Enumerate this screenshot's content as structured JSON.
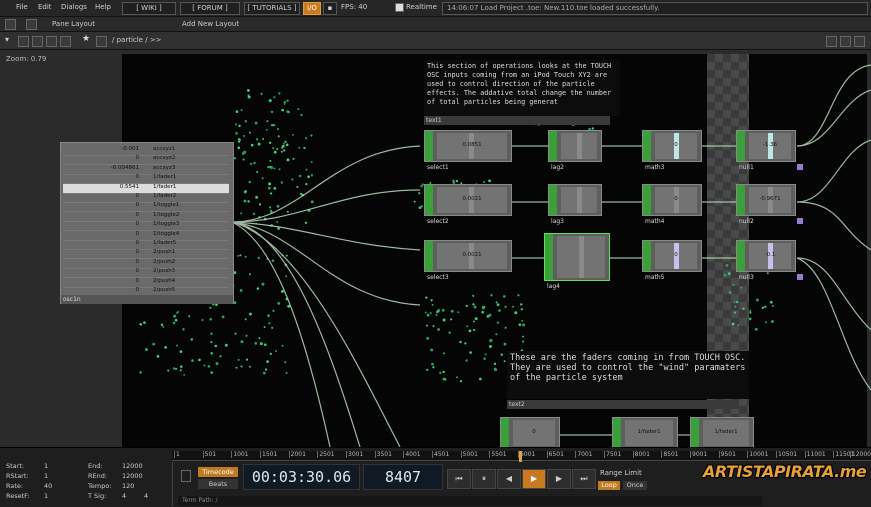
{
  "menu": {
    "file": "File",
    "edit": "Edit",
    "dialogs": "Dialogs",
    "help": "Help",
    "wiki": "[ WIKI ]",
    "forum": "[ FORUM ]",
    "tutorials": "[ TUTORIALS ]",
    "fps": "FPS: 40",
    "realtime": "Realtime",
    "log": "14:06:07 Load Project .toe: New.110.toe loaded successfully."
  },
  "layout": {
    "pane": "Pane Layout",
    "add": "Add New Layout"
  },
  "path": "/ particle / >>",
  "zoom": "Zoom: 0.79",
  "big_node": {
    "rows": [
      [
        "-0.001",
        "accxyz1"
      ],
      [
        "0",
        "accxyz2"
      ],
      [
        "-0.004861",
        "accxyz3"
      ],
      [
        "0",
        "1/fader1"
      ],
      [
        "0.5541",
        "1/fader1"
      ],
      [
        "0",
        "1/fader2"
      ],
      [
        "0",
        "1/toggle1"
      ],
      [
        "0",
        "1/toggle2"
      ],
      [
        "0",
        "1/toggle3"
      ],
      [
        "0",
        "1/toggle4"
      ],
      [
        "0",
        "1/fader5"
      ],
      [
        "0",
        "2/push1"
      ],
      [
        "0",
        "2/push2"
      ],
      [
        "0",
        "2/push3"
      ],
      [
        "0",
        "2/push4"
      ],
      [
        "0",
        "2/push5"
      ]
    ],
    "name": "osc1n"
  },
  "nodes": [
    {
      "label": "select1",
      "value": "0.0851"
    },
    {
      "label": "select2",
      "value": "0.0021"
    },
    {
      "label": "select3",
      "value": "0.0021"
    },
    {
      "label": "lag2",
      "value": ""
    },
    {
      "label": "lag3",
      "value": ""
    },
    {
      "label": "lag4",
      "value": ""
    },
    {
      "label": "math3",
      "value": "0"
    },
    {
      "label": "math4",
      "value": "0"
    },
    {
      "label": "math5",
      "value": "0"
    },
    {
      "label": "null1",
      "value": "-1.36"
    },
    {
      "label": "null2",
      "value": "-0.9671"
    },
    {
      "label": "null3",
      "value": "-0.1"
    }
  ],
  "comment1": {
    "text": "This section of operations looks at the TOUCH OSC inputs coming from an iPod Touch XY2 are used to control direction of the particle effects. The addative total change the number of total particles being generat",
    "name": "text1"
  },
  "comment2": {
    "text": "These are the faders coming in from TOUCH OSC. They are used to control the \"wind\" paramaters of the particle system",
    "name": "text2"
  },
  "bottom_row": [
    {
      "label": "",
      "value": "0"
    },
    {
      "label": "",
      "value": "1/fader1"
    },
    {
      "label": "",
      "value": "1/fader1"
    }
  ],
  "timeline_ticks": [
    "1",
    "501",
    "1001",
    "1501",
    "2001",
    "2501",
    "3001",
    "3501",
    "4001",
    "4501",
    "5001",
    "5501",
    "6001",
    "6501",
    "7001",
    "7501",
    "8001",
    "8501",
    "9001",
    "9501",
    "10001",
    "10501",
    "11001",
    "11501",
    "12000"
  ],
  "status": {
    "start_label": "Start:",
    "start": "1",
    "end_label": "End:",
    "end": "12000",
    "rstart_label": "RStart:",
    "rstart": "1",
    "rend_label": "REnd:",
    "rend": "12000",
    "rate_label": "Rate:",
    "rate": "40",
    "tempo_label": "Tempo:",
    "tempo": "120",
    "reset_label": "ResetF:",
    "reset": "1",
    "tsig_label": "T Sig:",
    "tsig_a": "4",
    "tsig_b": "4"
  },
  "timecode": "00:03:30.06",
  "frame": "8407",
  "timecode_btn": "Timecode",
  "beats_btn": "Beats",
  "range_limit": "Range Limit",
  "loop": "Loop",
  "once": "Once",
  "term_path": "Term Path: /",
  "watermark": "ARTISTAPIRATA.me",
  "watermark_tld": ".me",
  "accent": "#d8882e"
}
